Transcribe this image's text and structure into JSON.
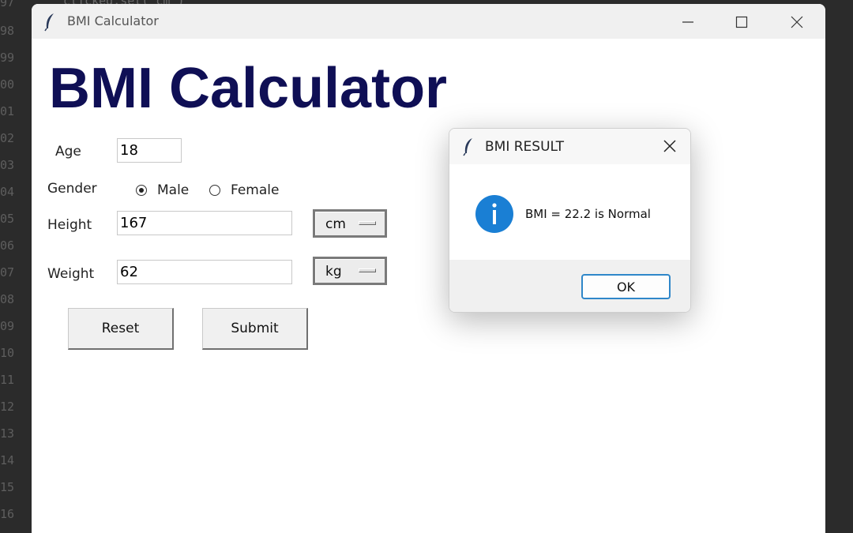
{
  "background": {
    "code_fragment": "clicked.set(\"cm\")",
    "line_numbers": [
      "97",
      "98",
      "99",
      "00",
      "01",
      "02",
      "03",
      "04",
      "05",
      "06",
      "07",
      "08",
      "09",
      "10",
      "11",
      "12",
      "13",
      "14",
      "15",
      "16"
    ]
  },
  "window": {
    "title": "BMI Calculator",
    "icon": "feather-icon",
    "controls": [
      "minimize-icon",
      "maximize-icon",
      "close-icon"
    ]
  },
  "app": {
    "heading": "BMI Calculator",
    "heading_color": "#0f0f55",
    "age": {
      "label": "Age",
      "value": "18"
    },
    "gender": {
      "label": "Gender",
      "options": [
        {
          "label": "Male",
          "checked": true
        },
        {
          "label": "Female",
          "checked": false
        }
      ]
    },
    "height": {
      "label": "Height",
      "value": "167",
      "unit": "cm"
    },
    "weight": {
      "label": "Weight",
      "value": "62",
      "unit": "kg"
    },
    "buttons": {
      "reset": "Reset",
      "submit": "Submit"
    }
  },
  "dialog": {
    "title": "BMI RESULT",
    "icon": "info-icon",
    "icon_color": "#1a7fd4",
    "message": "BMI = 22.2 is Normal",
    "ok": "OK",
    "ok_border_color": "#2f87c9"
  }
}
